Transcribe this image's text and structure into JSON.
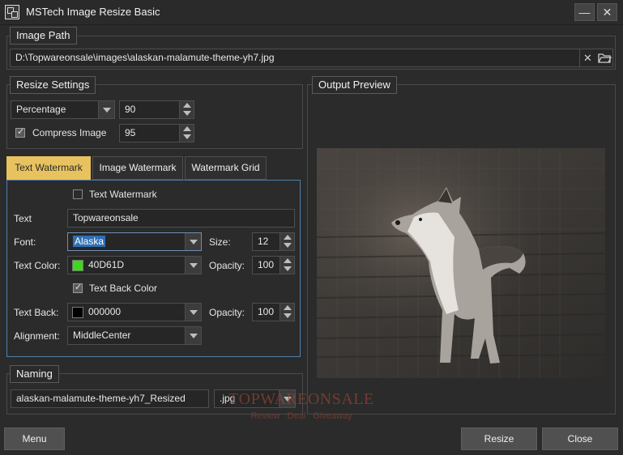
{
  "window": {
    "title": "MSTech Image Resize Basic",
    "minimize_symbol": "—",
    "close_symbol": "✕"
  },
  "image_path": {
    "legend": "Image Path",
    "value": "D:\\Topwareonsale\\images\\alaskan-malamute-theme-yh7.jpg"
  },
  "resize_settings": {
    "legend": "Resize Settings",
    "mode": "Percentage",
    "percent": "90",
    "compress_label": "Compress Image",
    "compress_checked": true,
    "quality": "95"
  },
  "tabs": [
    {
      "label": "Text Watermark",
      "active": true
    },
    {
      "label": "Image Watermark",
      "active": false
    },
    {
      "label": "Watermark Grid",
      "active": false
    }
  ],
  "text_watermark": {
    "enable_label": "Text Watermark",
    "enable_checked": false,
    "text_label": "Text",
    "text_value": "Topwareonsale",
    "font_label": "Font:",
    "font_value": "Alaska",
    "size_label": "Size:",
    "size_value": "12",
    "color_label": "Text Color:",
    "color_value": "40D61D",
    "color_hex": "#40D61D",
    "opacity_label": "Opacity:",
    "opacity_value": "100",
    "back_color_label": "Text Back Color",
    "back_color_checked": true,
    "back_label": "Text Back:",
    "back_value": "000000",
    "back_hex": "#000000",
    "back_opacity_label": "Opacity:",
    "back_opacity_value": "100",
    "alignment_label": "Alignment:",
    "alignment_value": "MiddleCenter"
  },
  "naming": {
    "legend": "Naming",
    "filename": "alaskan-malamute-theme-yh7_Resized",
    "extension": ".jpg"
  },
  "output_preview": {
    "legend": "Output Preview"
  },
  "watermark_overlay": {
    "logo_text": "TOPWAREONSALE",
    "tagline": "Review Deal Giveaway"
  },
  "footer": {
    "menu_label": "Menu",
    "resize_label": "Resize",
    "close_label": "Close"
  },
  "colors": {
    "accent_tab": "#e8c25e",
    "selection": "#2f6fb3"
  }
}
